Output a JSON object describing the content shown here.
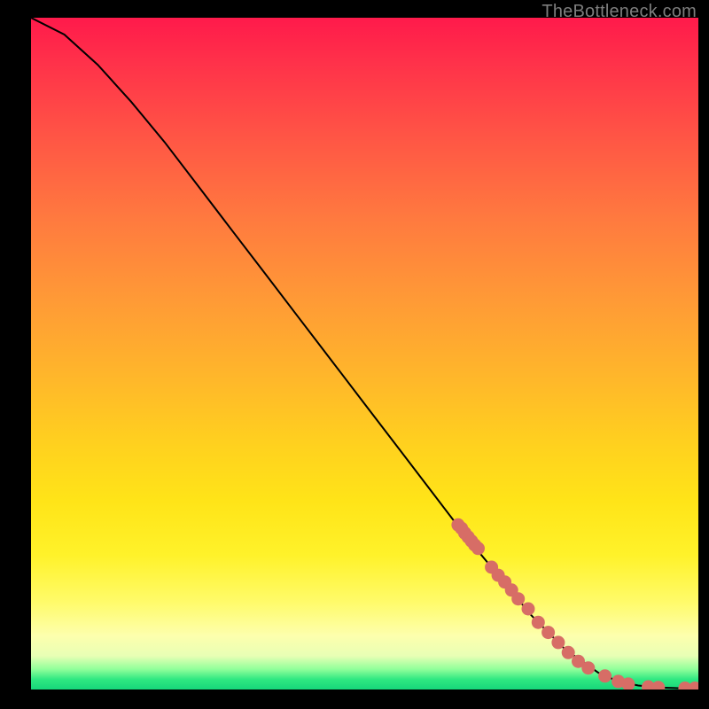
{
  "watermark": "TheBottleneck.com",
  "chart_data": {
    "type": "line",
    "title": "",
    "xlabel": "",
    "ylabel": "",
    "xlim": [
      0,
      100
    ],
    "ylim": [
      0,
      100
    ],
    "curve": {
      "name": "bottleneck-curve",
      "x": [
        0,
        5,
        10,
        15,
        20,
        25,
        30,
        35,
        40,
        45,
        50,
        55,
        60,
        65,
        70,
        75,
        80,
        85,
        88,
        91,
        94,
        97,
        100
      ],
      "y": [
        100,
        97.5,
        93,
        87.5,
        81.5,
        75,
        68.5,
        62,
        55.5,
        49,
        42.5,
        36,
        29.5,
        23,
        17,
        11,
        6,
        2.5,
        1.2,
        0.6,
        0.3,
        0.2,
        0.2
      ]
    },
    "markers": {
      "name": "highlight-segment",
      "color": "#d76d66",
      "points": [
        {
          "x": 64.0,
          "y": 24.5
        },
        {
          "x": 64.5,
          "y": 24.0
        },
        {
          "x": 65.0,
          "y": 23.3
        },
        {
          "x": 65.5,
          "y": 22.7
        },
        {
          "x": 66.0,
          "y": 22.1
        },
        {
          "x": 66.5,
          "y": 21.5
        },
        {
          "x": 67.0,
          "y": 21.0
        },
        {
          "x": 69.0,
          "y": 18.2
        },
        {
          "x": 70.0,
          "y": 17.0
        },
        {
          "x": 71.0,
          "y": 16.0
        },
        {
          "x": 72.0,
          "y": 14.8
        },
        {
          "x": 73.0,
          "y": 13.5
        },
        {
          "x": 74.5,
          "y": 12.0
        },
        {
          "x": 76.0,
          "y": 10.0
        },
        {
          "x": 77.5,
          "y": 8.5
        },
        {
          "x": 79.0,
          "y": 7.0
        },
        {
          "x": 80.5,
          "y": 5.5
        },
        {
          "x": 82.0,
          "y": 4.2
        },
        {
          "x": 83.5,
          "y": 3.2
        },
        {
          "x": 86.0,
          "y": 2.0
        },
        {
          "x": 88.0,
          "y": 1.2
        },
        {
          "x": 89.5,
          "y": 0.8
        },
        {
          "x": 92.5,
          "y": 0.4
        },
        {
          "x": 94.0,
          "y": 0.3
        },
        {
          "x": 98.0,
          "y": 0.2
        },
        {
          "x": 99.5,
          "y": 0.2
        }
      ]
    },
    "background": {
      "type": "vertical-gradient",
      "stops": [
        {
          "pos": 0.0,
          "color": "#ff1a4b"
        },
        {
          "pos": 0.5,
          "color": "#ffb82a"
        },
        {
          "pos": 0.8,
          "color": "#fff22a"
        },
        {
          "pos": 0.95,
          "color": "#e8ffb5"
        },
        {
          "pos": 1.0,
          "color": "#17d67a"
        }
      ]
    }
  }
}
